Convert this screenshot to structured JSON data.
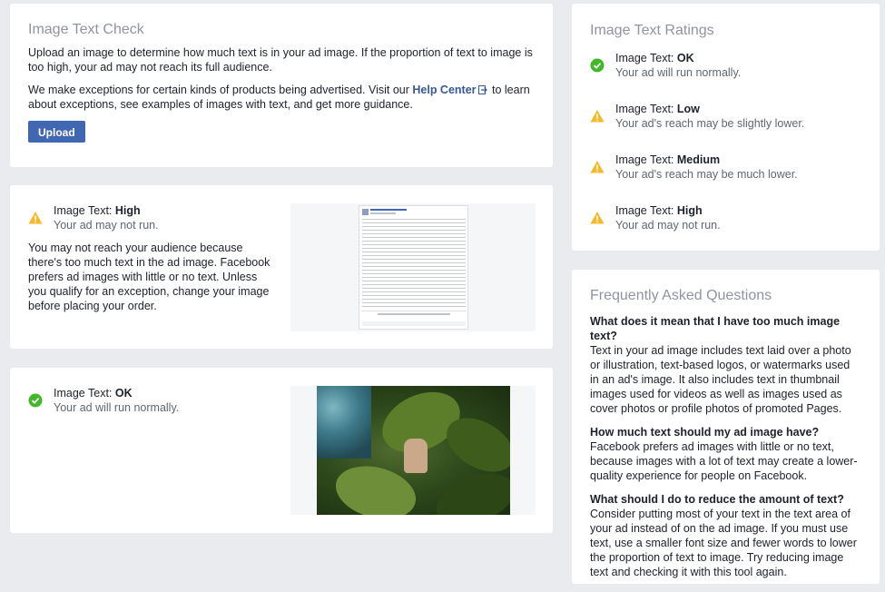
{
  "check_card": {
    "title": "Image Text Check",
    "intro": "Upload an image to determine how much text is in your ad image. If the proportion of text to image is too high, your ad may not reach its full audience.",
    "exceptions_before": "We make exceptions for certain kinds of products being advertised. Visit our ",
    "help_center_link": "Help Center",
    "exceptions_after": " to learn about exceptions, see examples of images with text, and get more guidance.",
    "upload_label": "Upload"
  },
  "result_high": {
    "prefix": "Image Text: ",
    "level": "High",
    "sub": "Your ad may not run.",
    "body": "You may not reach your audience because there's too much text in the ad image. Facebook prefers ad images with little or no text. Unless you qualify for an exception, change your image before placing your order."
  },
  "result_ok": {
    "prefix": "Image Text: ",
    "level": "OK",
    "sub": "Your ad will run normally."
  },
  "ratings_card": {
    "title": "Image Text Ratings",
    "items": [
      {
        "prefix": "Image Text: ",
        "level": "OK",
        "sub": "Your ad will run normally.",
        "icon": "check-circle-icon"
      },
      {
        "prefix": "Image Text: ",
        "level": "Low",
        "sub": "Your ad's reach may be slightly lower.",
        "icon": "warning-icon"
      },
      {
        "prefix": "Image Text: ",
        "level": "Medium",
        "sub": "Your ad's reach may be much lower.",
        "icon": "warning-icon"
      },
      {
        "prefix": "Image Text: ",
        "level": "High",
        "sub": "Your ad may not run.",
        "icon": "warning-icon"
      }
    ]
  },
  "faq_card": {
    "title": "Frequently Asked Questions",
    "items": [
      {
        "q": "What does it mean that I have too much image text?",
        "a": "Text in your ad image includes text laid over a photo or illustration, text-based logos, or watermarks used in an ad's image. It also includes text in thumbnail images used for videos as well as images used as cover photos or profile photos of promoted Pages."
      },
      {
        "q": "How much text should my ad image have?",
        "a": "Facebook prefers ad images with little or no text, because images with a lot of text may create a lower-quality experience for people on Facebook."
      },
      {
        "q": "What should I do to reduce the amount of text?",
        "a": "Consider putting most of your text in the text area of your ad instead of on the ad image. If you must use text, use a smaller font size and fewer words to lower the proportion of text to image. Try reducing image text and checking it with this tool again."
      }
    ]
  },
  "colors": {
    "ok_green": "#42b72a",
    "warning_yellow": "#f7b928",
    "link_blue": "#365899",
    "button_blue": "#4267b2"
  }
}
